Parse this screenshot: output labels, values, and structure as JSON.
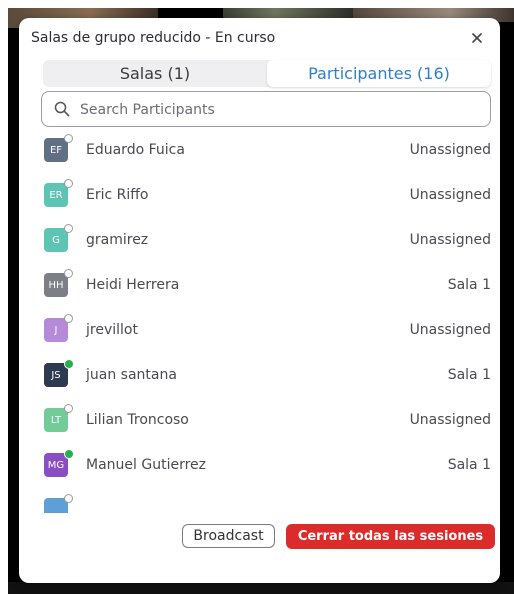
{
  "dialog": {
    "title": "Salas de grupo reducido - En curso",
    "close_icon": "close-icon"
  },
  "tabs": [
    {
      "label": "Salas (1)",
      "active": false
    },
    {
      "label": "Participantes (16)",
      "active": true
    }
  ],
  "search": {
    "placeholder": "Search Participants",
    "icon": "search-icon"
  },
  "participants": [
    {
      "initials": "EF",
      "name": "Eduardo Fuica",
      "room": "Unassigned",
      "avatar_color": "#5f6f86",
      "online": false
    },
    {
      "initials": "ER",
      "name": "Eric Riffo",
      "room": "Unassigned",
      "avatar_color": "#5ec4b3",
      "online": false
    },
    {
      "initials": "G",
      "name": "gramirez",
      "room": "Unassigned",
      "avatar_color": "#5ec4b3",
      "online": false
    },
    {
      "initials": "HH",
      "name": "Heidi Herrera",
      "room": "Sala 1",
      "avatar_color": "#7c7f86",
      "online": false
    },
    {
      "initials": "J",
      "name": "jrevillot",
      "room": "Unassigned",
      "avatar_color": "#b58ad9",
      "online": false
    },
    {
      "initials": "JS",
      "name": "juan santana",
      "room": "Sala 1",
      "avatar_color": "#2e3a50",
      "online": true
    },
    {
      "initials": "LT",
      "name": "Lilian Troncoso",
      "room": "Unassigned",
      "avatar_color": "#73cc97",
      "online": false
    },
    {
      "initials": "MG",
      "name": "Manuel Gutierrez",
      "room": "Sala 1",
      "avatar_color": "#8a4ec4",
      "online": true
    },
    {
      "initials": "",
      "name": "",
      "room": "",
      "avatar_color": "#5d9fd6",
      "online": false
    }
  ],
  "footer": {
    "broadcast_label": "Broadcast",
    "end_all_label": "Cerrar todas las sesiones"
  },
  "colors": {
    "accent": "#2e7fd0",
    "danger": "#dc2b2b",
    "online": "#22b24c"
  }
}
